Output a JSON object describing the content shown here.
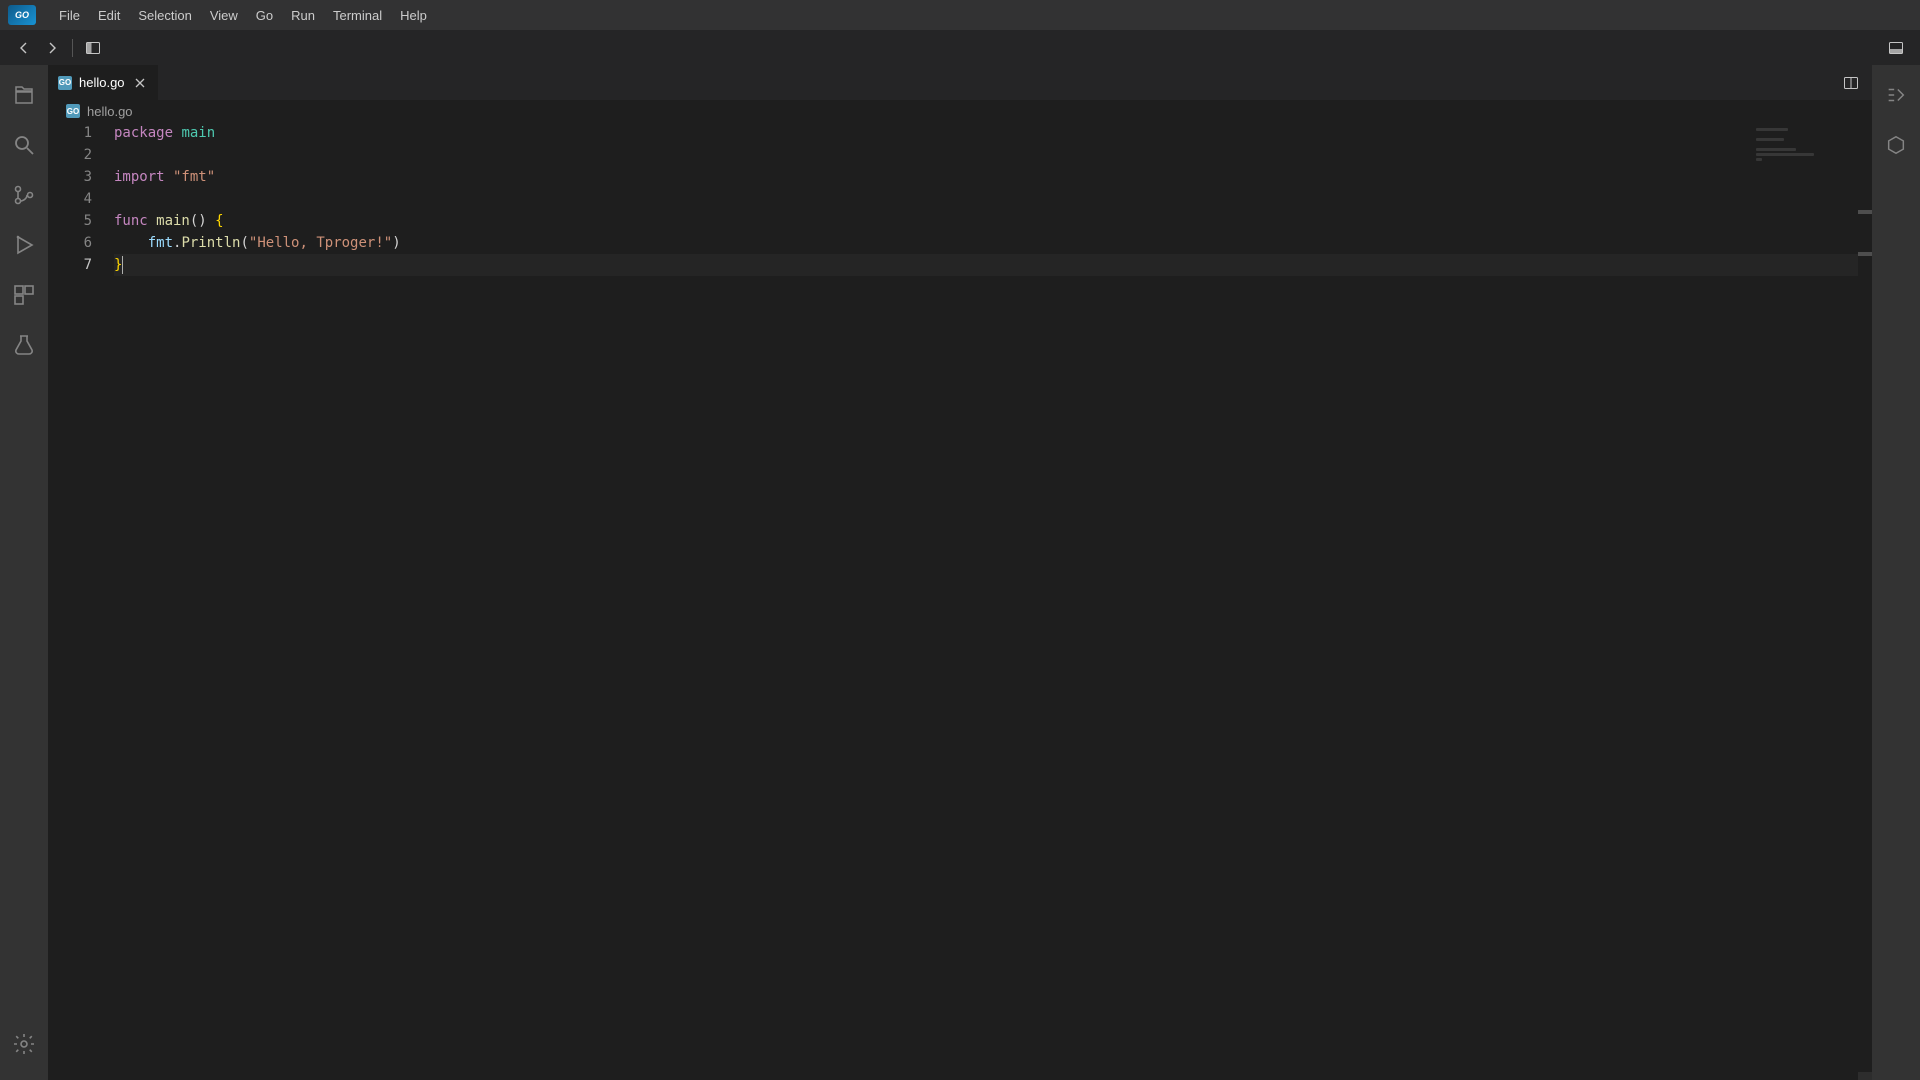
{
  "accent": "#007acc",
  "menu": [
    "File",
    "Edit",
    "Selection",
    "View",
    "Go",
    "Run",
    "Terminal",
    "Help"
  ],
  "tab": {
    "name": "hello.go"
  },
  "breadcrumb": {
    "file": "hello.go"
  },
  "code": {
    "lines": [
      {
        "n": 1
      },
      {
        "n": 2
      },
      {
        "n": 3
      },
      {
        "n": 4
      },
      {
        "n": 5
      },
      {
        "n": 6
      },
      {
        "n": 7,
        "active": true
      }
    ],
    "tokens": {
      "l1_kw": "package",
      "l1_name": " main",
      "l3_kw": "import",
      "l3_str": " \"fmt\"",
      "l5_kw": "func",
      "l5_name": " main",
      "l5_par": "()",
      "l5_ob": " {",
      "l6_indent": "    ",
      "l6_obj": "fmt",
      "l6_dot": ".",
      "l6_fn": "Println",
      "l6_op": "(",
      "l6_str": "\"Hello, Tproger!\"",
      "l6_cp": ")",
      "l7_cb": "}"
    }
  },
  "logo_text": "GO"
}
